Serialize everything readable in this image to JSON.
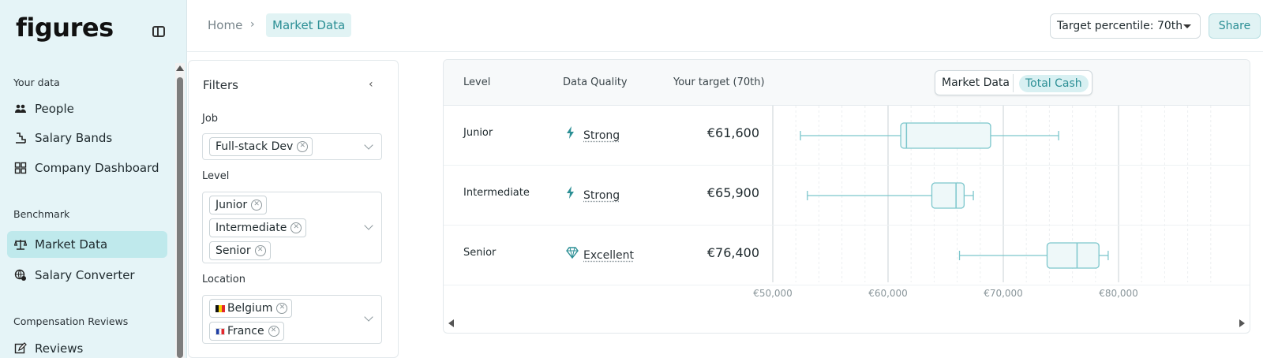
{
  "app": {
    "logo_text": "figures"
  },
  "sidebar": {
    "sections": [
      {
        "title": "Your data",
        "items": [
          {
            "label": "People",
            "icon": "people-icon"
          },
          {
            "label": "Salary Bands",
            "icon": "salary-bands-icon"
          },
          {
            "label": "Company Dashboard",
            "icon": "dashboard-icon"
          }
        ]
      },
      {
        "title": "Benchmark",
        "items": [
          {
            "label": "Market Data",
            "icon": "scale-icon",
            "active": true
          },
          {
            "label": "Salary Converter",
            "icon": "globe-icon"
          }
        ]
      },
      {
        "title": "Compensation Reviews",
        "items": [
          {
            "label": "Reviews",
            "icon": "edit-icon"
          }
        ]
      }
    ]
  },
  "header": {
    "breadcrumb_home": "Home",
    "breadcrumb_sep": "›",
    "breadcrumb_current": "Market Data",
    "percentile_select": "Target percentile: 70th",
    "share_label": "Share"
  },
  "filters": {
    "title": "Filters",
    "collapse_glyph": "‹",
    "job_label": "Job",
    "job_values": [
      "Full-stack Dev"
    ],
    "level_label": "Level",
    "level_values": [
      "Junior",
      "Intermediate",
      "Senior"
    ],
    "location_label": "Location",
    "location_values": [
      "Belgium",
      "France"
    ]
  },
  "table": {
    "columns": {
      "level": "Level",
      "quality": "Data Quality",
      "target": "Your target (70th)"
    },
    "toggle": {
      "option_a": "Market Data",
      "option_b": "Total Cash",
      "selected": "Total Cash"
    },
    "rows": [
      {
        "level": "Junior",
        "quality": "Strong",
        "quality_icon": "bolt-icon",
        "target": "€61,600"
      },
      {
        "level": "Intermediate",
        "quality": "Strong",
        "quality_icon": "bolt-icon",
        "target": "€65,900"
      },
      {
        "level": "Senior",
        "quality": "Excellent",
        "quality_icon": "diamond-icon",
        "target": "€76,400"
      }
    ]
  },
  "chart_data": {
    "type": "boxplot",
    "x_ticks": [
      "€50,000",
      "€60,000",
      "€70,000",
      "€80,000"
    ],
    "xlim": [
      50000,
      90000
    ],
    "grid": true,
    "series": [
      {
        "category": "Junior",
        "min": 52400,
        "q1": 61100,
        "median": 61600,
        "q3": 68900,
        "max": 74800
      },
      {
        "category": "Intermediate",
        "min": 53000,
        "q1": 63800,
        "median": 65900,
        "q3": 66600,
        "max": 67400
      },
      {
        "category": "Senior",
        "min": 66200,
        "q1": 73800,
        "median": 76400,
        "q3": 78300,
        "max": 79100
      }
    ],
    "colors": {
      "stroke": "#7cc6cc",
      "fill": "#eef8f9"
    }
  }
}
